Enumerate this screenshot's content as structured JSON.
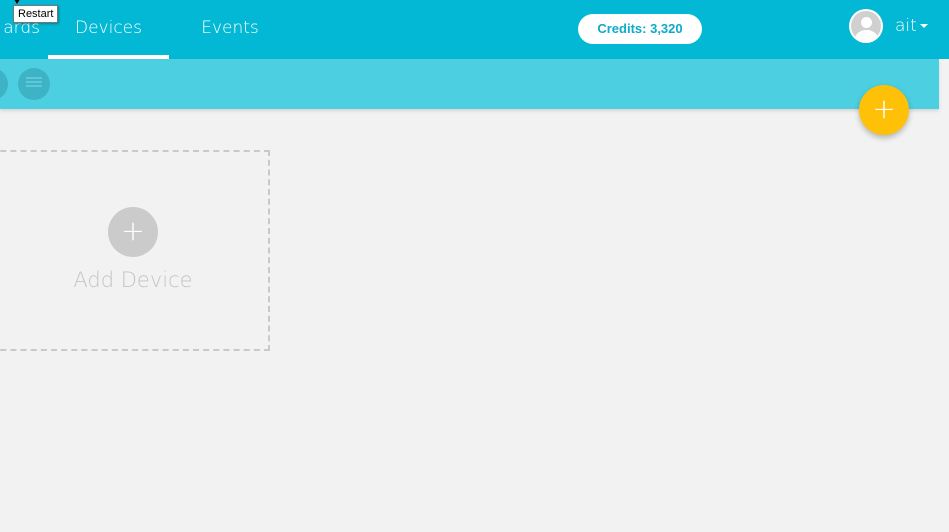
{
  "nav": {
    "tabs": [
      {
        "label": "ards",
        "active": false
      },
      {
        "label": "Devices",
        "active": true
      },
      {
        "label": "Events",
        "active": false
      }
    ],
    "credits": "Credits: 3,320",
    "user_name": "ait",
    "icons": {
      "avatar": "user-avatar-icon",
      "caret": "caret-down-icon"
    }
  },
  "toolbar": {
    "icons": [
      "grid-view-icon",
      "list-view-icon"
    ]
  },
  "fab": {
    "label": "+",
    "icon": "plus-icon",
    "color": "#ffc107"
  },
  "add_device": {
    "plus": "+",
    "label": "Add Device"
  },
  "tooltip": {
    "text": "Restart"
  },
  "colors": {
    "primary": "#03b8d4",
    "subbar": "#4ccfe1",
    "accent": "#ffc107"
  }
}
